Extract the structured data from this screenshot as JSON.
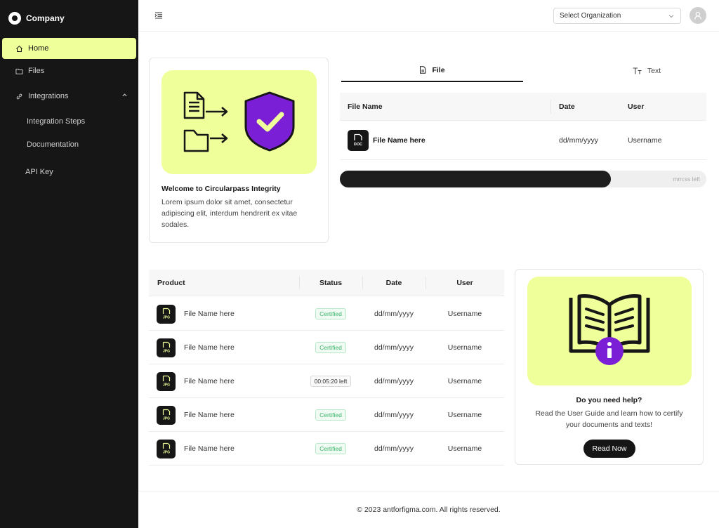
{
  "sidebar": {
    "brand": "Company",
    "items": [
      {
        "label": "Home",
        "icon": "home-icon",
        "active": true
      },
      {
        "label": "Files",
        "icon": "folder-icon"
      },
      {
        "label": "Integrations",
        "icon": "link-icon",
        "expanded": true
      },
      {
        "label": "Integration Steps"
      },
      {
        "label": "Documentation"
      },
      {
        "label": "API Key"
      }
    ]
  },
  "header": {
    "org_placeholder": "Select Organization"
  },
  "welcome": {
    "title": "Welcome to Circularpass Integrity",
    "description": "Lorem ipsum dolor sit amet, consectetur adipiscing elit, interdum hendrerit ex vitae sodales."
  },
  "upload": {
    "tabs": [
      "File",
      "Text"
    ],
    "columns": [
      "File Name",
      "Date",
      "User"
    ],
    "row": {
      "file_type": "DOC",
      "name": "File Name here",
      "date": "dd/mm/yyyy",
      "user": "Username"
    },
    "progress": 0.74,
    "progress_label": "mm:ss left"
  },
  "products": {
    "columns": [
      "Product",
      "Status",
      "Date",
      "User"
    ],
    "rows": [
      {
        "file_type": "JPG",
        "name": "File Name here",
        "status": "Certified",
        "date": "dd/mm/yyyy",
        "user": "Username"
      },
      {
        "file_type": "JPG",
        "name": "File Name here",
        "status": "Certified",
        "date": "dd/mm/yyyy",
        "user": "Username"
      },
      {
        "file_type": "JPG",
        "name": "File Name here",
        "status": "00:05:20 left",
        "date": "dd/mm/yyyy",
        "user": "Username"
      },
      {
        "file_type": "JPG",
        "name": "File Name here",
        "status": "Certified",
        "date": "dd/mm/yyyy",
        "user": "Username"
      },
      {
        "file_type": "JPG",
        "name": "File Name here",
        "status": "Certified",
        "date": "dd/mm/yyyy",
        "user": "Username"
      }
    ]
  },
  "help": {
    "title": "Do you need help?",
    "description": "Read the User Guide and learn how to certify your documents and texts!",
    "button": "Read Now"
  },
  "footer": {
    "text": "© 2023 antforfigma.com. All rights reserved."
  },
  "colors": {
    "accent": "#efff9a",
    "sidebar": "#161616",
    "shield": "#7b1fd6",
    "certified": "#3bb56b"
  }
}
